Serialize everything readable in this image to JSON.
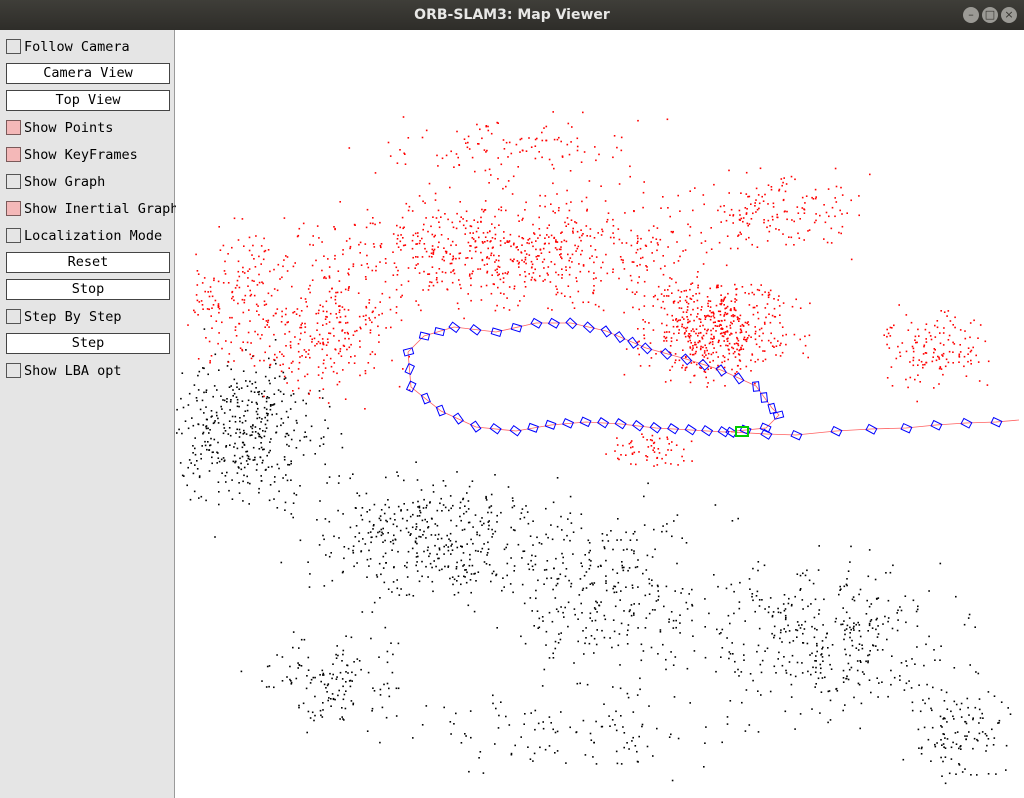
{
  "window": {
    "title": "ORB-SLAM3: Map Viewer",
    "controls": {
      "minimize": "–",
      "maximize": "□",
      "close": "×"
    }
  },
  "panel": {
    "follow_camera": {
      "label": "Follow Camera",
      "checked": false
    },
    "camera_view": "Camera View",
    "top_view": "Top View",
    "show_points": {
      "label": "Show Points",
      "checked": true
    },
    "show_keyframes": {
      "label": "Show KeyFrames",
      "checked": true
    },
    "show_graph": {
      "label": "Show Graph",
      "checked": false
    },
    "show_inertial_graph": {
      "label": "Show Inertial Graph",
      "checked": true
    },
    "localization_mode": {
      "label": "Localization Mode",
      "checked": false
    },
    "reset": "Reset",
    "stop": "Stop",
    "step_by_step": {
      "label": "Step By Step",
      "checked": false
    },
    "step": "Step",
    "show_lba_opt": {
      "label": "Show LBA opt",
      "checked": false
    }
  },
  "colors": {
    "map_points_reference": "#ff0000",
    "map_points": "#000000",
    "keyframes": "#0000ff",
    "current_camera": "#00cc00",
    "inertial_graph": "#ff6060",
    "checkbox_checked": "#f4b8b8"
  }
}
